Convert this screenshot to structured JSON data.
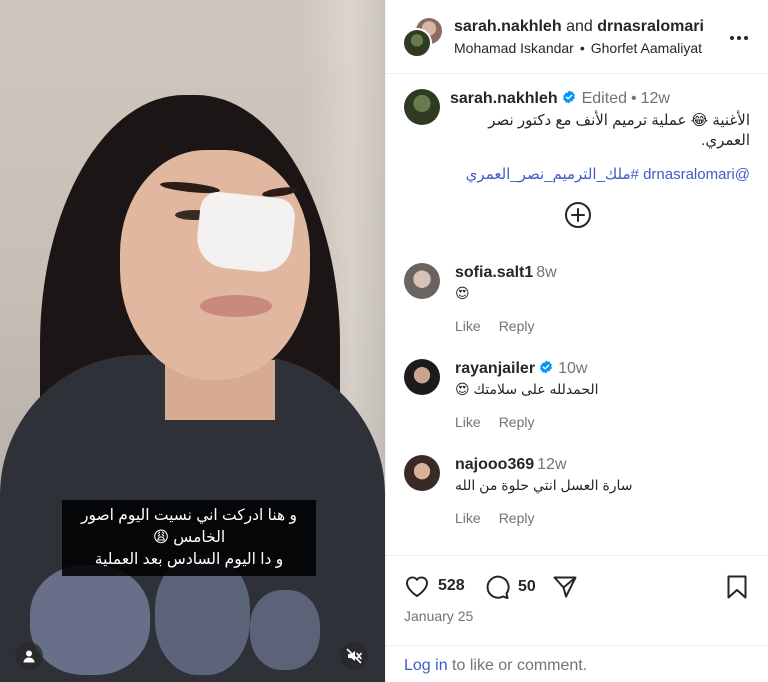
{
  "header": {
    "author_1": "sarah.nakhleh",
    "joiner": "and",
    "author_2": "drnasralomari",
    "music_artist": "Mohamad Iskandar",
    "separator": "•",
    "music_track": "Ghorfet Aamaliyat"
  },
  "media": {
    "caption_line1": "و هنا ادركت اني نسيت اليوم اصور",
    "caption_line2": "الخامس 😩",
    "caption_line3": "و دا اليوم السادس بعد العملية"
  },
  "post": {
    "username": "sarah.nakhleh",
    "edited": "Edited",
    "separator": "•",
    "age": "12w",
    "body": "الأغنية 😂 عملية ترميم الأنف مع دكتور نصر العمري.",
    "tags": "@drnasralomari #ملك_الترميم_نصر_العمري"
  },
  "comments": [
    {
      "user": "sofia.salt1",
      "verified": false,
      "age": "8w",
      "text": "😍",
      "like": "Like",
      "reply": "Reply"
    },
    {
      "user": "rayanjailer",
      "verified": true,
      "age": "10w",
      "text": "الحمدلله على سلامتك 😍",
      "like": "Like",
      "reply": "Reply"
    },
    {
      "user": "najooo369",
      "verified": false,
      "age": "12w",
      "text": "سارة العسل انتي حلوة من الله",
      "like": "Like",
      "reply": "Reply"
    }
  ],
  "actions": {
    "likes": "528",
    "comments": "50",
    "date": "January 25"
  },
  "login": {
    "link": "Log in",
    "text": " to like or comment."
  },
  "icons": [
    "more-icon",
    "verified-icon",
    "add-comment-icon",
    "heart-icon",
    "comment-icon",
    "share-icon",
    "bookmark-icon",
    "user-tag-icon",
    "mute-icon"
  ],
  "colors": {
    "link": "#3f5bc9",
    "verified": "#0095f6",
    "muted": "#737373",
    "text": "#262626"
  }
}
